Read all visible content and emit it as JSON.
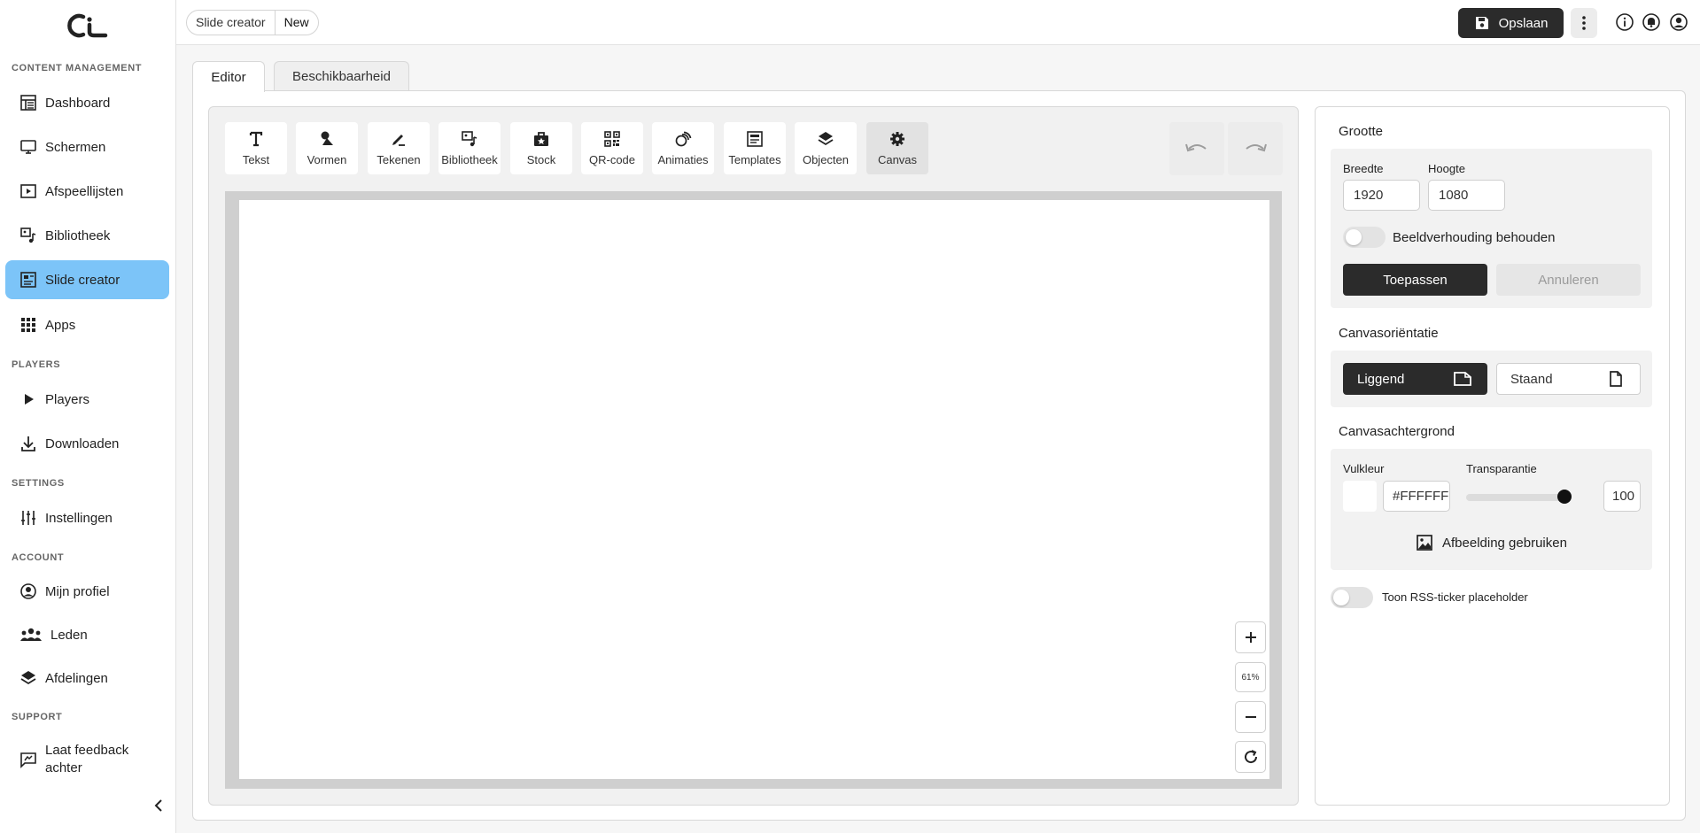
{
  "sidebar": {
    "sections": {
      "content": "CONTENT MANAGEMENT",
      "players": "PLAYERS",
      "settings": "SETTINGS",
      "account": "ACCOUNT",
      "support": "SUPPORT"
    },
    "items": {
      "dashboard": "Dashboard",
      "schermen": "Schermen",
      "afspeellijsten": "Afspeellijsten",
      "bibliotheek": "Bibliotheek",
      "slide_creator": "Slide creator",
      "apps": "Apps",
      "players": "Players",
      "downloaden": "Downloaden",
      "instellingen": "Instellingen",
      "mijn_profiel": "Mijn profiel",
      "leden": "Leden",
      "afdelingen": "Afdelingen",
      "feedback": "Laat feedback achter"
    }
  },
  "header": {
    "breadcrumb": [
      "Slide creator",
      "New"
    ],
    "save_label": "Opslaan"
  },
  "tabs": {
    "editor": "Editor",
    "availability": "Beschikbaarheid"
  },
  "toolbar": {
    "tekst": "Tekst",
    "vormen": "Vormen",
    "tekenen": "Tekenen",
    "bibliotheek": "Bibliotheek",
    "stock": "Stock",
    "qr": "QR-code",
    "animaties": "Animaties",
    "templates": "Templates",
    "objecten": "Objecten",
    "canvas": "Canvas"
  },
  "zoom": {
    "level": "61%"
  },
  "panel": {
    "size_title": "Grootte",
    "width_label": "Breedte",
    "width_value": "1920",
    "height_label": "Hoogte",
    "height_value": "1080",
    "keep_ratio_label": "Beeldverhouding behouden",
    "apply_label": "Toepassen",
    "cancel_label": "Annuleren",
    "orientation_title": "Canvasoriëntatie",
    "landscape_label": "Liggend",
    "portrait_label": "Staand",
    "background_title": "Canvasachtergrond",
    "fill_label": "Vulkleur",
    "fill_value": "#FFFFFF",
    "transparency_label": "Transparantie",
    "transparency_value": "100",
    "use_image_label": "Afbeelding gebruiken",
    "rss_label": "Toon RSS-ticker placeholder"
  },
  "colors": {
    "active_nav": "#7cc4f8",
    "dark_button": "#2b2b2b"
  }
}
